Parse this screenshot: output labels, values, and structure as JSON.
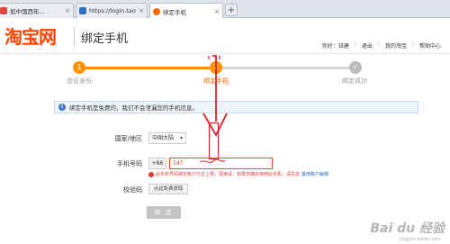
{
  "browser": {
    "tabs": [
      {
        "label": "如中国西年...",
        "icon": "page-icon",
        "icon_color": "#e0453a"
      },
      {
        "label": "https://login.taobao.com/m...",
        "icon": "page-icon",
        "icon_color": "#2f6fc2"
      },
      {
        "label": "绑定手机",
        "icon": "taobao-icon",
        "icon_color": "#ff6a00"
      }
    ],
    "new_tab": "+"
  },
  "header": {
    "logo": "淘宝网",
    "title": "绑定手机",
    "links": [
      "你好：钰建",
      "退出",
      "我的淘宝",
      "帮助中心"
    ]
  },
  "progress": {
    "steps": [
      {
        "num": "1",
        "label": "验证身份"
      },
      {
        "num": "2",
        "label": "绑定手机"
      },
      {
        "num": "✓",
        "label": "绑定成功"
      }
    ],
    "completed_fraction": 0.5,
    "active_color": "#ff9100"
  },
  "notice": {
    "text": "绑定手机是免费的，我们不会泄漏您的手机信息。"
  },
  "form": {
    "region_label": "国家/地区",
    "region_value": "中国大陆",
    "phone_label": "手机号码",
    "phone_prefix": "+86",
    "phone_value": "147",
    "error_text": "此手机号码绑定账户已达上限，更换请：如果您确实使用此手机，请先去",
    "error_link": "其他账户解绑",
    "code_label": "校验码",
    "sms_button": "点此免费获取",
    "submit": "绑 定"
  },
  "watermark": {
    "text": "Bai du 经验",
    "sub": "jingyan.baidu.com"
  },
  "colors": {
    "brand": "#ff4400",
    "error": "#e03b2e",
    "annotation": "#e02020"
  }
}
